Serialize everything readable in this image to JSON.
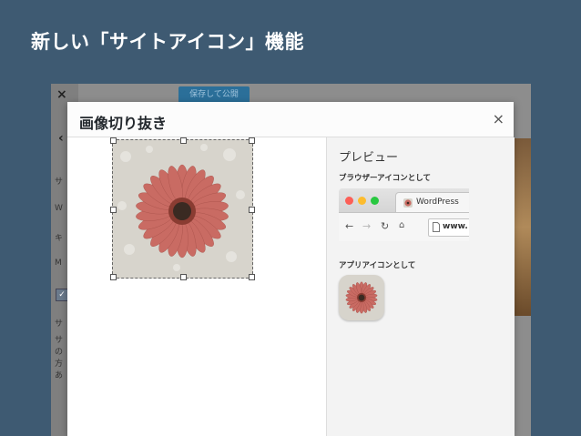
{
  "slide": {
    "title": "新しい「サイトアイコン」機能"
  },
  "background": {
    "close_symbol": "×",
    "save_button_label": "保存して公開",
    "fragments": [
      "サ",
      "W",
      "キ",
      "M",
      "サ",
      "サ",
      "の",
      "方",
      "あ"
    ]
  },
  "modal": {
    "title": "画像切り抜き",
    "close_symbol": "×"
  },
  "preview": {
    "heading": "プレビュー",
    "browser_label": "ブラウザーアイコンとして",
    "tab_title": "WordPress",
    "url_text": "www.",
    "app_label": "アプリアイコンとして"
  },
  "colors": {
    "slide_background": "#3e5a72",
    "flower_petal": "#c96b63",
    "flower_center": "#3a2a22",
    "traffic_red": "#fc5f57",
    "traffic_yellow": "#fdbc2e",
    "traffic_green": "#28c840"
  },
  "icons": [
    "close-icon",
    "back-arrow-icon",
    "forward-arrow-icon",
    "reload-icon",
    "home-icon",
    "page-icon",
    "favicon-icon"
  ]
}
